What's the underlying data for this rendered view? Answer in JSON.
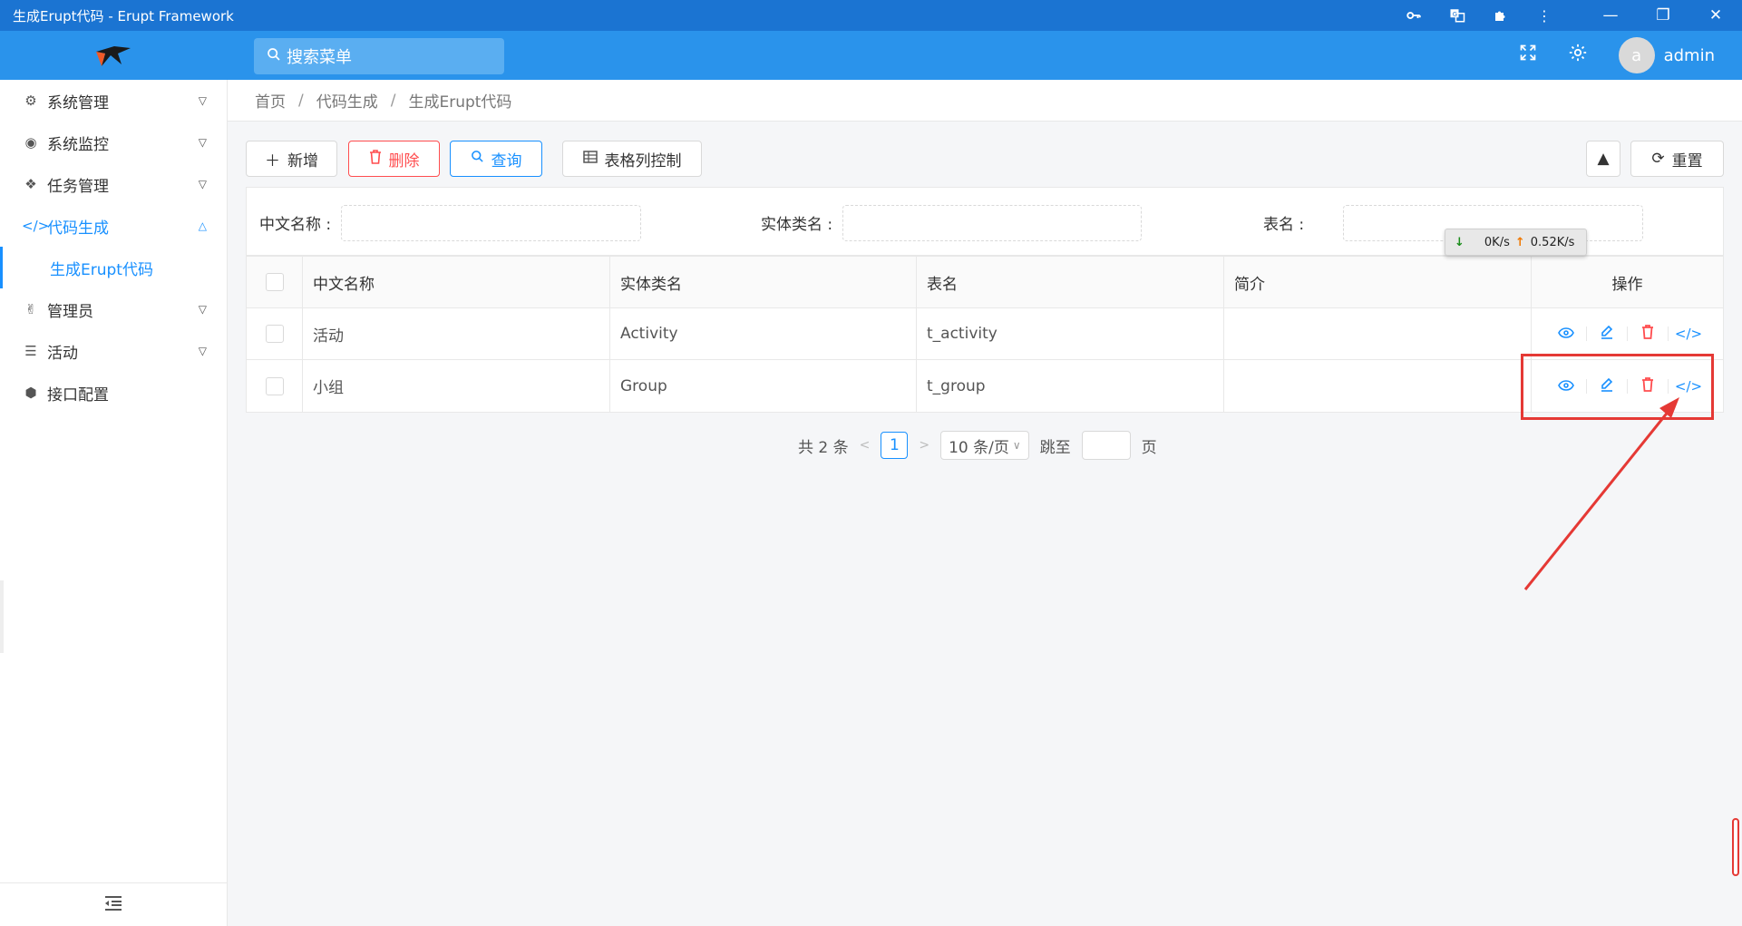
{
  "window": {
    "title": "生成Erupt代码 - Erupt Framework",
    "icons": [
      "key-icon",
      "translate-icon",
      "extension-icon",
      "more-icon"
    ],
    "controls": {
      "minimize": "—",
      "restore": "❐",
      "close": "✕"
    }
  },
  "header": {
    "search_placeholder": "搜索菜单",
    "user_initial": "a",
    "username": "admin"
  },
  "sidebar": {
    "items": [
      {
        "label": "系统管理",
        "icon": "gears-icon",
        "expanded": false
      },
      {
        "label": "系统监控",
        "icon": "monitor-icon",
        "expanded": false
      },
      {
        "label": "任务管理",
        "icon": "cubes-icon",
        "expanded": false
      },
      {
        "label": "代码生成",
        "icon": "code-icon",
        "expanded": true,
        "active": true,
        "children": [
          {
            "label": "生成Erupt代码",
            "active": true
          }
        ]
      },
      {
        "label": "管理员",
        "icon": "hand-icon",
        "expanded": false
      },
      {
        "label": "活动",
        "icon": "list-icon",
        "expanded": false
      },
      {
        "label": "接口配置",
        "icon": "box-icon"
      }
    ]
  },
  "breadcrumb": [
    "首页",
    "代码生成",
    "生成Erupt代码"
  ],
  "toolbar": {
    "add_label": "新增",
    "delete_label": "删除",
    "query_label": "查询",
    "columns_label": "表格列控制",
    "reset_label": "重置"
  },
  "search_form": {
    "fields": [
      {
        "label": "中文名称 :",
        "value": ""
      },
      {
        "label": "实体类名 :",
        "value": ""
      },
      {
        "label": "表名 :",
        "value": ""
      }
    ]
  },
  "table": {
    "columns": [
      "中文名称",
      "实体类名",
      "表名",
      "简介",
      "操作"
    ],
    "rows": [
      {
        "name": "活动",
        "class": "Activity",
        "table": "t_activity",
        "desc": ""
      },
      {
        "name": "小组",
        "class": "Group",
        "table": "t_group",
        "desc": ""
      }
    ]
  },
  "pagination": {
    "total_text": "共 2 条",
    "current_page": "1",
    "page_size": "10 条/页",
    "jump_label": "跳至",
    "page_suffix": "页"
  },
  "net_speed": {
    "down": "0K/s",
    "up": "0.52K/s"
  },
  "colors": {
    "titlebar": "#1b74d2",
    "header": "#2a93eb",
    "primary": "#1890ff",
    "danger": "#ff4d4f",
    "annotation": "#e53935"
  }
}
